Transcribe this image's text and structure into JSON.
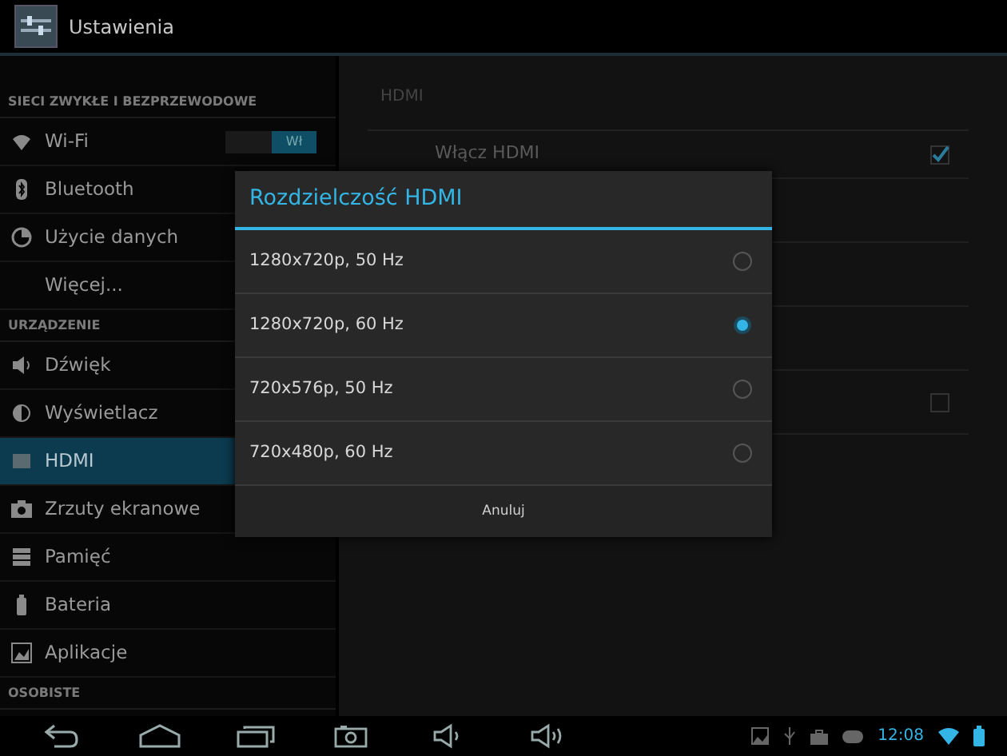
{
  "action_bar": {
    "title": "Ustawienia"
  },
  "sidebar": [
    {
      "kind": "header",
      "label": "SIECI ZWYKŁE I BEZPRZEWODOWE"
    },
    {
      "kind": "item",
      "label": "Wi-Fi",
      "selected": false,
      "toggle": {
        "label": "Wł",
        "on": true
      }
    },
    {
      "kind": "item",
      "label": "Bluetooth",
      "selected": false
    },
    {
      "kind": "item",
      "label": "Użycie danych",
      "selected": false
    },
    {
      "kind": "item",
      "label": "Więcej...",
      "selected": false
    },
    {
      "kind": "header",
      "label": "URZĄDZENIE"
    },
    {
      "kind": "item",
      "label": "Dźwięk",
      "selected": false
    },
    {
      "kind": "item",
      "label": "Wyświetlacz",
      "selected": false
    },
    {
      "kind": "item",
      "label": "HDMI",
      "selected": true
    },
    {
      "kind": "item",
      "label": "Zrzuty ekranowe",
      "selected": false
    },
    {
      "kind": "item",
      "label": "Pamięć",
      "selected": false
    },
    {
      "kind": "item",
      "label": "Bateria",
      "selected": false
    },
    {
      "kind": "item",
      "label": "Aplikacje",
      "selected": false
    },
    {
      "kind": "header",
      "label": "OSOBISTE"
    }
  ],
  "pane": {
    "header": "HDMI",
    "rows": [
      {
        "label": "Włącz HDMI",
        "checked": true
      },
      {
        "checked": false
      }
    ]
  },
  "dialog": {
    "title": "Rozdzielczość HDMI",
    "options": [
      {
        "label": "1280x720p, 50 Hz",
        "selected": false
      },
      {
        "label": "1280x720p, 60 Hz",
        "selected": true
      },
      {
        "label": "720x576p, 50 Hz",
        "selected": false
      },
      {
        "label": "720x480p, 60 Hz",
        "selected": false
      }
    ],
    "button": "Anuluj"
  },
  "status_bar": {
    "time": "12:08"
  }
}
